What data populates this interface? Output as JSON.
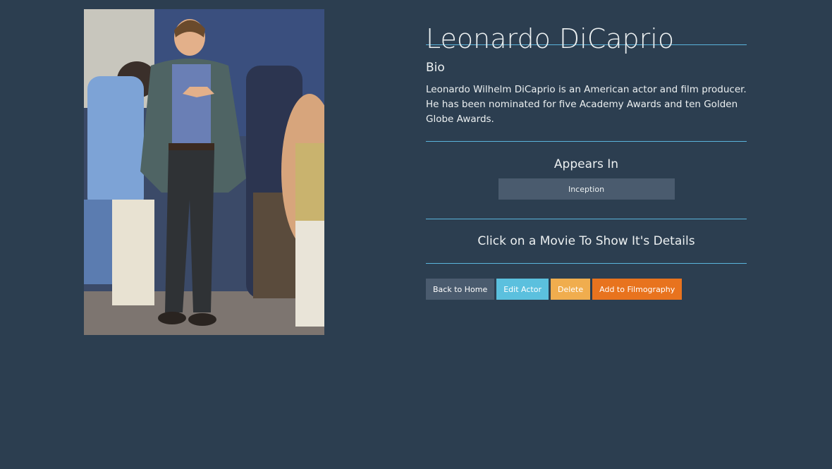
{
  "actor": {
    "name": "Leonardo DiCaprio",
    "photo_icon": "actor-photo"
  },
  "bio": {
    "heading": "Bio",
    "text": "Leonardo Wilhelm DiCaprio is an American actor and film producer. He has been nominated for five Academy Awards and ten Golden Globe Awards."
  },
  "appears_in": {
    "heading": "Appears In",
    "movies": [
      "Inception"
    ]
  },
  "hint": {
    "text": "Click on a Movie To Show It's Details"
  },
  "actions": {
    "back_label": "Back to Home",
    "edit_label": "Edit Actor",
    "delete_label": "Delete",
    "add_label": "Add to Filmography"
  },
  "colors": {
    "background": "#2c3e50",
    "rule": "#5ab4dc",
    "btn_default": "#4a5b6e",
    "btn_info": "#5bc0de",
    "btn_warning": "#f0ad4e",
    "btn_orange": "#e8731e"
  }
}
